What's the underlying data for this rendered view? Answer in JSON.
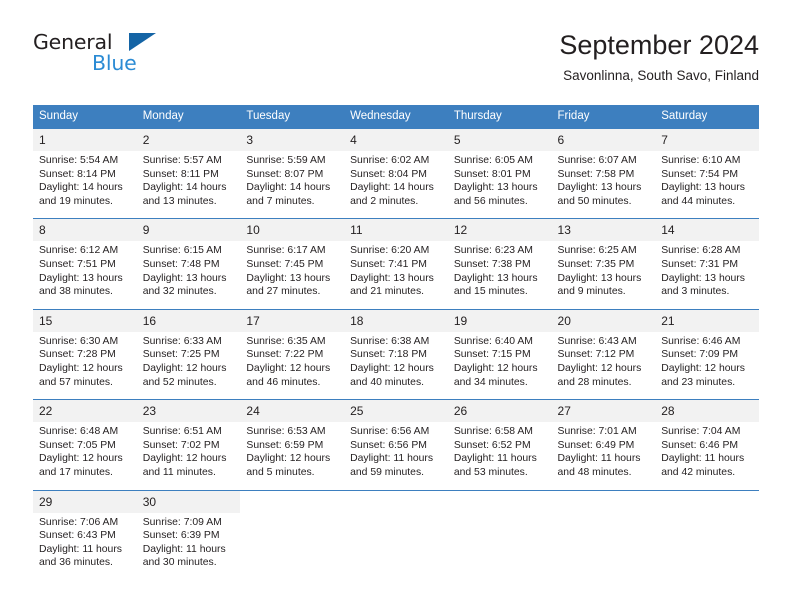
{
  "brand": {
    "name_top": "General",
    "name_bottom": "Blue",
    "color_dark": "#231f20",
    "color_blue": "#2b8bd4",
    "triangle_color": "#1464a5"
  },
  "header": {
    "title": "September 2024",
    "subtitle": "Savonlinna, South Savo, Finland"
  },
  "theme": {
    "header_bg": "#3d7fbf",
    "header_text": "#ffffff",
    "daynum_bg": "#f2f2f2",
    "cell_bg": "#ffffff",
    "text": "#231f20"
  },
  "weekday_headers": [
    "Sunday",
    "Monday",
    "Tuesday",
    "Wednesday",
    "Thursday",
    "Friday",
    "Saturday"
  ],
  "labels": {
    "sunrise": "Sunrise:",
    "sunset": "Sunset:",
    "daylight": "Daylight:"
  },
  "weeks": [
    [
      {
        "day": "1",
        "sunrise": "Sunrise: 5:54 AM",
        "sunset": "Sunset: 8:14 PM",
        "daylight": "Daylight: 14 hours and 19 minutes."
      },
      {
        "day": "2",
        "sunrise": "Sunrise: 5:57 AM",
        "sunset": "Sunset: 8:11 PM",
        "daylight": "Daylight: 14 hours and 13 minutes."
      },
      {
        "day": "3",
        "sunrise": "Sunrise: 5:59 AM",
        "sunset": "Sunset: 8:07 PM",
        "daylight": "Daylight: 14 hours and 7 minutes."
      },
      {
        "day": "4",
        "sunrise": "Sunrise: 6:02 AM",
        "sunset": "Sunset: 8:04 PM",
        "daylight": "Daylight: 14 hours and 2 minutes."
      },
      {
        "day": "5",
        "sunrise": "Sunrise: 6:05 AM",
        "sunset": "Sunset: 8:01 PM",
        "daylight": "Daylight: 13 hours and 56 minutes."
      },
      {
        "day": "6",
        "sunrise": "Sunrise: 6:07 AM",
        "sunset": "Sunset: 7:58 PM",
        "daylight": "Daylight: 13 hours and 50 minutes."
      },
      {
        "day": "7",
        "sunrise": "Sunrise: 6:10 AM",
        "sunset": "Sunset: 7:54 PM",
        "daylight": "Daylight: 13 hours and 44 minutes."
      }
    ],
    [
      {
        "day": "8",
        "sunrise": "Sunrise: 6:12 AM",
        "sunset": "Sunset: 7:51 PM",
        "daylight": "Daylight: 13 hours and 38 minutes."
      },
      {
        "day": "9",
        "sunrise": "Sunrise: 6:15 AM",
        "sunset": "Sunset: 7:48 PM",
        "daylight": "Daylight: 13 hours and 32 minutes."
      },
      {
        "day": "10",
        "sunrise": "Sunrise: 6:17 AM",
        "sunset": "Sunset: 7:45 PM",
        "daylight": "Daylight: 13 hours and 27 minutes."
      },
      {
        "day": "11",
        "sunrise": "Sunrise: 6:20 AM",
        "sunset": "Sunset: 7:41 PM",
        "daylight": "Daylight: 13 hours and 21 minutes."
      },
      {
        "day": "12",
        "sunrise": "Sunrise: 6:23 AM",
        "sunset": "Sunset: 7:38 PM",
        "daylight": "Daylight: 13 hours and 15 minutes."
      },
      {
        "day": "13",
        "sunrise": "Sunrise: 6:25 AM",
        "sunset": "Sunset: 7:35 PM",
        "daylight": "Daylight: 13 hours and 9 minutes."
      },
      {
        "day": "14",
        "sunrise": "Sunrise: 6:28 AM",
        "sunset": "Sunset: 7:31 PM",
        "daylight": "Daylight: 13 hours and 3 minutes."
      }
    ],
    [
      {
        "day": "15",
        "sunrise": "Sunrise: 6:30 AM",
        "sunset": "Sunset: 7:28 PM",
        "daylight": "Daylight: 12 hours and 57 minutes."
      },
      {
        "day": "16",
        "sunrise": "Sunrise: 6:33 AM",
        "sunset": "Sunset: 7:25 PM",
        "daylight": "Daylight: 12 hours and 52 minutes."
      },
      {
        "day": "17",
        "sunrise": "Sunrise: 6:35 AM",
        "sunset": "Sunset: 7:22 PM",
        "daylight": "Daylight: 12 hours and 46 minutes."
      },
      {
        "day": "18",
        "sunrise": "Sunrise: 6:38 AM",
        "sunset": "Sunset: 7:18 PM",
        "daylight": "Daylight: 12 hours and 40 minutes."
      },
      {
        "day": "19",
        "sunrise": "Sunrise: 6:40 AM",
        "sunset": "Sunset: 7:15 PM",
        "daylight": "Daylight: 12 hours and 34 minutes."
      },
      {
        "day": "20",
        "sunrise": "Sunrise: 6:43 AM",
        "sunset": "Sunset: 7:12 PM",
        "daylight": "Daylight: 12 hours and 28 minutes."
      },
      {
        "day": "21",
        "sunrise": "Sunrise: 6:46 AM",
        "sunset": "Sunset: 7:09 PM",
        "daylight": "Daylight: 12 hours and 23 minutes."
      }
    ],
    [
      {
        "day": "22",
        "sunrise": "Sunrise: 6:48 AM",
        "sunset": "Sunset: 7:05 PM",
        "daylight": "Daylight: 12 hours and 17 minutes."
      },
      {
        "day": "23",
        "sunrise": "Sunrise: 6:51 AM",
        "sunset": "Sunset: 7:02 PM",
        "daylight": "Daylight: 12 hours and 11 minutes."
      },
      {
        "day": "24",
        "sunrise": "Sunrise: 6:53 AM",
        "sunset": "Sunset: 6:59 PM",
        "daylight": "Daylight: 12 hours and 5 minutes."
      },
      {
        "day": "25",
        "sunrise": "Sunrise: 6:56 AM",
        "sunset": "Sunset: 6:56 PM",
        "daylight": "Daylight: 11 hours and 59 minutes."
      },
      {
        "day": "26",
        "sunrise": "Sunrise: 6:58 AM",
        "sunset": "Sunset: 6:52 PM",
        "daylight": "Daylight: 11 hours and 53 minutes."
      },
      {
        "day": "27",
        "sunrise": "Sunrise: 7:01 AM",
        "sunset": "Sunset: 6:49 PM",
        "daylight": "Daylight: 11 hours and 48 minutes."
      },
      {
        "day": "28",
        "sunrise": "Sunrise: 7:04 AM",
        "sunset": "Sunset: 6:46 PM",
        "daylight": "Daylight: 11 hours and 42 minutes."
      }
    ],
    [
      {
        "day": "29",
        "sunrise": "Sunrise: 7:06 AM",
        "sunset": "Sunset: 6:43 PM",
        "daylight": "Daylight: 11 hours and 36 minutes."
      },
      {
        "day": "30",
        "sunrise": "Sunrise: 7:09 AM",
        "sunset": "Sunset: 6:39 PM",
        "daylight": "Daylight: 11 hours and 30 minutes."
      },
      null,
      null,
      null,
      null,
      null
    ]
  ]
}
